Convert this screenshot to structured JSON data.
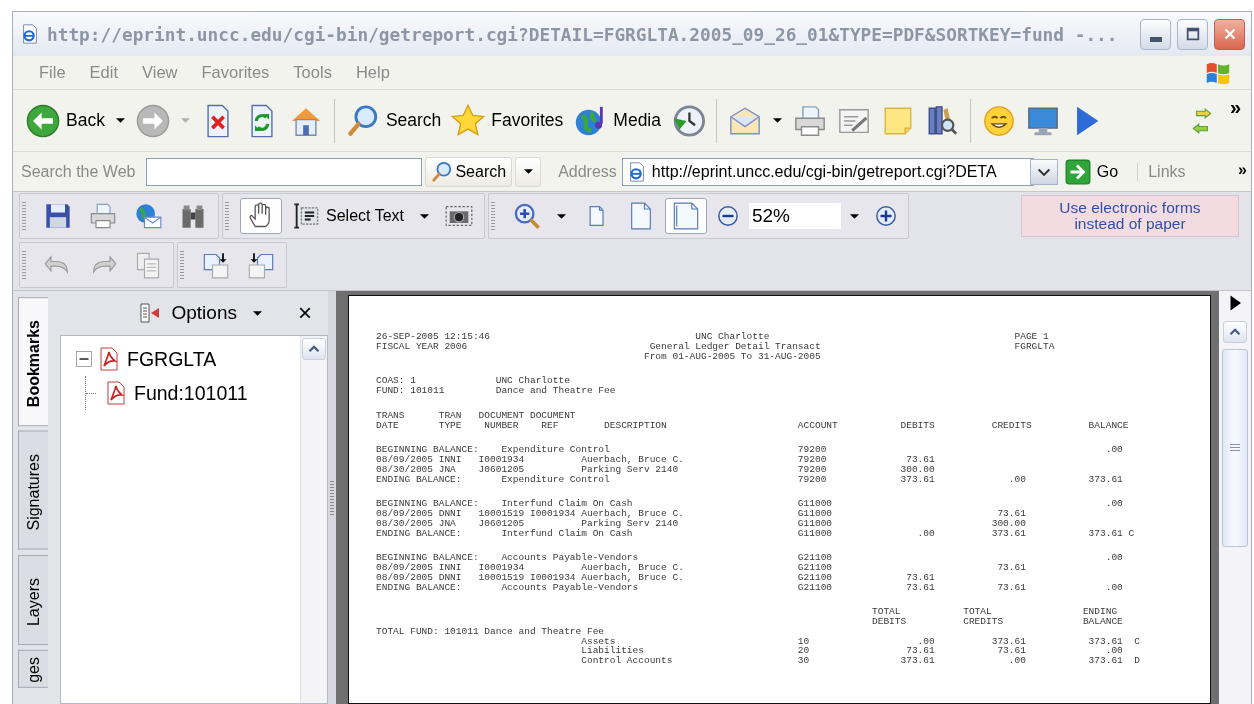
{
  "window": {
    "title": "http://eprint.uncc.edu/cgi-bin/getreport.cgi?DETAIL=FGRGLTA.2005_09_26_01&TYPE=PDF&SORTKEY=fund -..."
  },
  "menu": [
    "File",
    "Edit",
    "View",
    "Favorites",
    "Tools",
    "Help"
  ],
  "toolbar": {
    "back": "Back",
    "search": "Search",
    "favorites": "Favorites",
    "media": "Media",
    "chevron": "»"
  },
  "address_bar": {
    "search_label": "Search the Web",
    "search_button": "Search",
    "address_label": "Address",
    "address": "http://eprint.uncc.edu/cgi-bin/getreport.cgi?DETA",
    "go": "Go",
    "links": "Links",
    "chevron": "»"
  },
  "acrobat": {
    "tools": [
      {
        "kind": "hand",
        "selected": true
      },
      {
        "kind": "select_text",
        "label": "Select Text",
        "selected": false
      },
      {
        "kind": "snapshot",
        "selected": false
      }
    ],
    "page_views": [
      {
        "kind": "actual_size",
        "selected": false
      },
      {
        "kind": "fit_page",
        "selected": false
      },
      {
        "kind": "fit_width",
        "selected": true
      }
    ],
    "zoom": "52%",
    "banner": "Use electronic forms instead of paper"
  },
  "nav_panel": {
    "tabs": [
      {
        "label": "Bookmarks",
        "selected": true
      },
      {
        "label": "Signatures",
        "selected": false
      },
      {
        "label": "Layers",
        "selected": false
      },
      {
        "label": "ges",
        "selected": false
      }
    ],
    "options": "Options",
    "close": "×",
    "bookmarks": [
      {
        "label": "FGRGLTA",
        "expanded": true,
        "children": [
          {
            "label": "Fund:101011"
          }
        ]
      }
    ]
  },
  "document": {
    "blocks": [
      {
        "lines": [
          "26-SEP-2005 12:15:46                                    UNC Charlotte                                           PAGE 1",
          "FISCAL YEAR 2006                                General Ledger Detail Transact                                  FGRGLTA",
          "                                               From 01-AUG-2005 To 31-AUG-2005"
        ]
      },
      {
        "lines": [
          "COAS: 1              UNC Charlotte",
          "FUND: 101011         Dance and Theatre Fee"
        ]
      },
      {
        "lines": [
          "TRANS      TRAN   DOCUMENT DOCUMENT",
          "DATE       TYPE    NUMBER    REF        DESCRIPTION                       ACCOUNT           DEBITS          CREDITS          BALANCE"
        ]
      },
      {
        "lines": [
          "BEGINNING BALANCE:    Expenditure Control                                 79200                                                 .00",
          "08/09/2005 INNI   I0001934          Auerbach, Bruce C.                    79200              73.61",
          "08/30/2005 JNA    J0601205          Parking Serv 2140                     79200             300.00",
          "ENDING BALANCE:       Expenditure Control                                 79200             373.61             .00           373.61"
        ]
      },
      {
        "lines": [
          "BEGINNING BALANCE:    Interfund Claim On Cash                             G11000                                                .00",
          "08/09/2005 DNNI   10001519 I0001934 Auerbach, Bruce C.                    G11000                             73.61",
          "08/30/2005 JNA    J0601205          Parking Serv 2140                     G11000                            300.00",
          "ENDING BALANCE:       Interfund Claim On Cash                             G11000               .00          373.61           373.61 C"
        ]
      },
      {
        "lines": [
          "BEGINNING BALANCE:    Accounts Payable-Vendors                            G21100                                                .00",
          "08/09/2005 INNI   I0001934          Auerbach, Bruce C.                    G21100                             73.61",
          "08/09/2005 DNNI   10001519 I0001934 Auerbach, Bruce C.                    G21100             73.61",
          "ENDING BALANCE:       Accounts Payable-Vendors                            G21100             73.61           73.61              .00"
        ]
      },
      {
        "lines": [
          "                                                                                       TOTAL           TOTAL                ENDING",
          "                                                                                       DEBITS          CREDITS              BALANCE",
          "TOTAL FUND: 101011 Dance and Theatre Fee",
          "                                    Assets                                10                   .00          373.61           373.61  C",
          "                                    Liabilities                           20                 73.61           73.61              .00",
          "                                    Control Accounts                      30                373.61             .00           373.61  D"
        ]
      }
    ]
  }
}
